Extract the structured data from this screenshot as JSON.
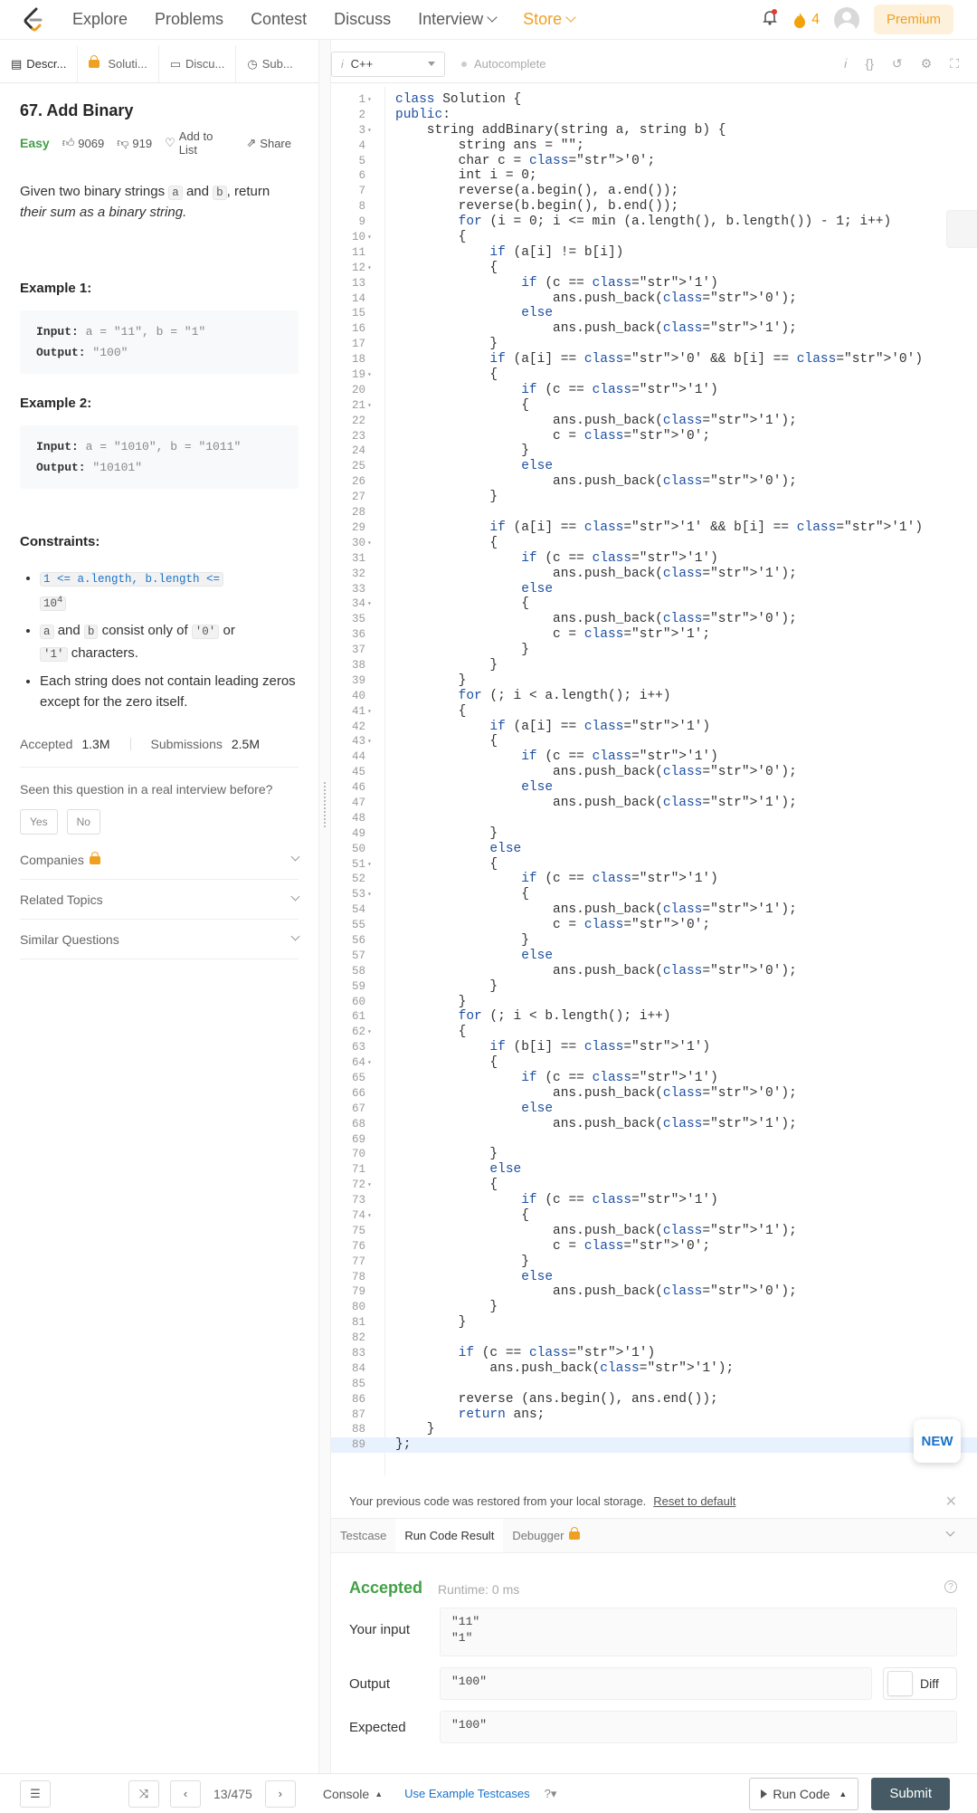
{
  "nav": {
    "explore": "Explore",
    "problems": "Problems",
    "contest": "Contest",
    "discuss": "Discuss",
    "interview": "Interview",
    "store": "Store",
    "streak": "4",
    "premium": "Premium"
  },
  "left_tabs": [
    "Descr...",
    "Soluti...",
    "Discu...",
    "Sub..."
  ],
  "problem": {
    "title": "67. Add Binary",
    "difficulty": "Easy",
    "likes": "9069",
    "dislikes": "919",
    "add_to_list": "Add to List",
    "share": "Share",
    "p1": "Given two binary strings",
    "a": "a",
    "and": "and",
    "b": "b",
    "p2": ", return",
    "p3": "their sum as a binary string.",
    "ex1_h": "Example 1:",
    "ex1_in_label": "Input:",
    "ex1_in": "a = \"11\", b = \"1\"",
    "ex1_out_label": "Output:",
    "ex1_out": "\"100\"",
    "ex2_h": "Example 2:",
    "ex2_in_label": "Input:",
    "ex2_in": "a = \"1010\", b = \"1011\"",
    "ex2_out_label": "Output:",
    "ex2_out": "\"10101\"",
    "constraints_h": "Constraints:",
    "c1": "1 <= a.length, b.length <=",
    "c1b": "10",
    "c1sup": "4",
    "c2a": "a",
    "c2and": "and",
    "c2b": "b",
    "c2txt": "consist only of",
    "c2z": "'0'",
    "c2or": "or",
    "c2o": "'1'",
    "c2end": "characters.",
    "c3": "Each string does not contain leading zeros except for the zero itself.",
    "accepted_label": "Accepted",
    "accepted": "1.3M",
    "submissions_label": "Submissions",
    "submissions": "2.5M",
    "seen": "Seen this question in a real interview before?",
    "yes": "Yes",
    "no": "No",
    "companies": "Companies",
    "related": "Related Topics",
    "similar": "Similar Questions"
  },
  "editor": {
    "language": "C++",
    "autocomplete": "Autocomplete",
    "lines": [
      "class Solution {",
      "public:",
      "    string addBinary(string a, string b) {",
      "        string ans = \"\";",
      "        char c = '0';",
      "        int i = 0;",
      "        reverse(a.begin(), a.end());",
      "        reverse(b.begin(), b.end());",
      "        for (i = 0; i <= min (a.length(), b.length()) - 1; i++)",
      "        {",
      "            if (a[i] != b[i])",
      "            {",
      "                if (c == '1')",
      "                    ans.push_back('0');",
      "                else",
      "                    ans.push_back('1');",
      "            }",
      "            if (a[i] == '0' && b[i] == '0')",
      "            {",
      "                if (c == '1')",
      "                {",
      "                    ans.push_back('1');",
      "                    c = '0';",
      "                }",
      "                else",
      "                    ans.push_back('0');",
      "            }",
      "",
      "            if (a[i] == '1' && b[i] == '1')",
      "            {",
      "                if (c == '1')",
      "                    ans.push_back('1');",
      "                else",
      "                {",
      "                    ans.push_back('0');",
      "                    c = '1';",
      "                }",
      "            }",
      "        }",
      "        for (; i < a.length(); i++)",
      "        {",
      "            if (a[i] == '1')",
      "            {",
      "                if (c == '1')",
      "                    ans.push_back('0');",
      "                else",
      "                    ans.push_back('1');",
      "",
      "            }",
      "            else",
      "            {",
      "                if (c == '1')",
      "                {",
      "                    ans.push_back('1');",
      "                    c = '0';",
      "                }",
      "                else",
      "                    ans.push_back('0');",
      "            }",
      "        }",
      "        for (; i < b.length(); i++)",
      "        {",
      "            if (b[i] == '1')",
      "            {",
      "                if (c == '1')",
      "                    ans.push_back('0');",
      "                else",
      "                    ans.push_back('1');",
      "",
      "            }",
      "            else",
      "            {",
      "                if (c == '1')",
      "                {",
      "                    ans.push_back('1');",
      "                    c = '0';",
      "                }",
      "                else",
      "                    ans.push_back('0');",
      "            }",
      "        }",
      "",
      "        if (c == '1')",
      "            ans.push_back('1');",
      "",
      "        reverse (ans.begin(), ans.end());",
      "        return ans;",
      "    }",
      "};"
    ],
    "fold_lines": [
      1,
      3,
      10,
      12,
      19,
      21,
      30,
      34,
      41,
      43,
      51,
      53,
      62,
      64,
      72,
      74
    ],
    "new_badge": "NEW"
  },
  "restore": {
    "msg": "Your previous code was restored from your local storage.",
    "reset": "Reset to default"
  },
  "result_tabs": [
    "Testcase",
    "Run Code Result",
    "Debugger"
  ],
  "result": {
    "status": "Accepted",
    "runtime": "Runtime: 0 ms",
    "input_label": "Your input",
    "input_l1": "\"11\"",
    "input_l2": "\"1\"",
    "output_label": "Output",
    "output": "\"100\"",
    "expected_label": "Expected",
    "expected": "\"100\"",
    "diff": "Diff"
  },
  "bottom": {
    "page": "13/475",
    "console": "Console",
    "use_example": "Use Example Testcases",
    "run": "Run Code",
    "submit": "Submit"
  }
}
